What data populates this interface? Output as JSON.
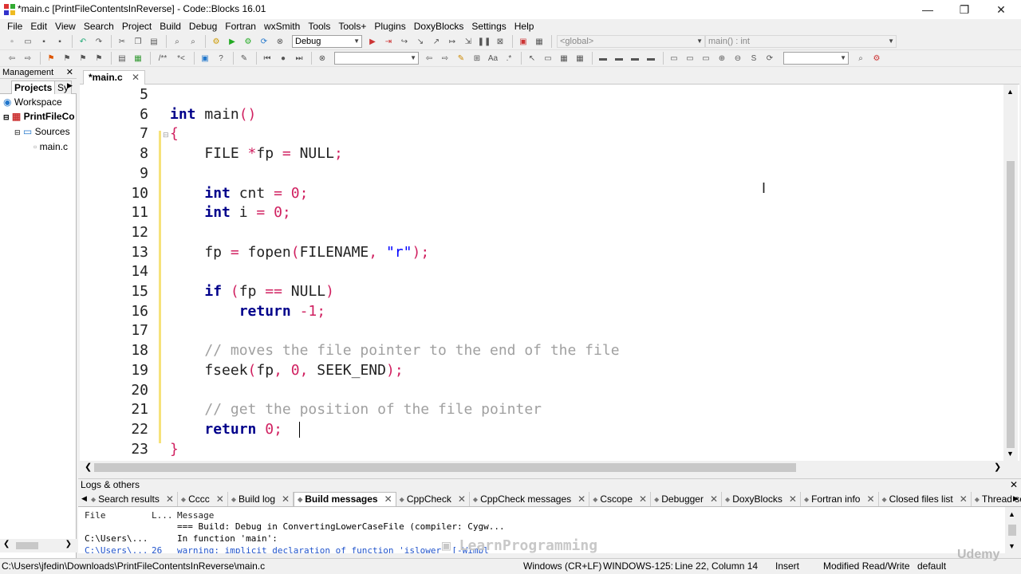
{
  "window": {
    "title": "*main.c [PrintFileContentsInReverse] - Code::Blocks 16.01"
  },
  "menu": [
    "File",
    "Edit",
    "View",
    "Search",
    "Project",
    "Build",
    "Debug",
    "Fortran",
    "wxSmith",
    "Tools",
    "Tools+",
    "Plugins",
    "DoxyBlocks",
    "Settings",
    "Help"
  ],
  "toolbar": {
    "build_target": "Debug",
    "scope": "<global>",
    "function": "main() : int"
  },
  "management": {
    "title": "Management",
    "tabs": [
      "Projects",
      "Sy"
    ],
    "tree": {
      "workspace": "Workspace",
      "project": "PrintFileCo",
      "sources": "Sources",
      "file": "main.c"
    }
  },
  "editor": {
    "tab": "*main.c",
    "lines": [
      {
        "n": "5",
        "html": ""
      },
      {
        "n": "6",
        "html": "<span class=\"kw\">int</span> main<span class=\"op\">()</span>"
      },
      {
        "n": "7",
        "html": "<span class=\"op\">{</span>"
      },
      {
        "n": "8",
        "html": "    FILE <span class=\"op\">*</span>fp <span class=\"op\">=</span> NULL<span class=\"op\">;</span>"
      },
      {
        "n": "9",
        "html": ""
      },
      {
        "n": "10",
        "html": "    <span class=\"kw\">int</span> cnt <span class=\"op\">=</span> <span class=\"num\">0</span><span class=\"op\">;</span>"
      },
      {
        "n": "11",
        "html": "    <span class=\"kw\">int</span> i <span class=\"op\">=</span> <span class=\"num\">0</span><span class=\"op\">;</span>"
      },
      {
        "n": "12",
        "html": ""
      },
      {
        "n": "13",
        "html": "    fp <span class=\"op\">=</span> fopen<span class=\"op\">(</span>FILENAME<span class=\"op\">,</span> <span class=\"str\">\"r\"</span><span class=\"op\">);</span>"
      },
      {
        "n": "14",
        "html": ""
      },
      {
        "n": "15",
        "html": "    <span class=\"kw\">if</span> <span class=\"op\">(</span>fp <span class=\"op\">==</span> NULL<span class=\"op\">)</span>"
      },
      {
        "n": "16",
        "html": "        <span class=\"kw\">return</span> <span class=\"op\">-</span><span class=\"num\">1</span><span class=\"op\">;</span>"
      },
      {
        "n": "17",
        "html": ""
      },
      {
        "n": "18",
        "html": "    <span class=\"cmt\">// moves the file pointer to the end of the file</span>"
      },
      {
        "n": "19",
        "html": "    fseek<span class=\"op\">(</span>fp<span class=\"op\">,</span> <span class=\"num\">0</span><span class=\"op\">,</span> SEEK_END<span class=\"op\">);</span>"
      },
      {
        "n": "20",
        "html": ""
      },
      {
        "n": "21",
        "html": "    <span class=\"cmt\">// get the position of the file pointer</span>"
      },
      {
        "n": "22",
        "html": "    <span class=\"kw\">return</span> <span class=\"num\">0</span><span class=\"op\">;</span>"
      },
      {
        "n": "23",
        "html": "<span class=\"op\">}</span>"
      }
    ]
  },
  "logs": {
    "title": "Logs & others",
    "tabs": [
      "Search results",
      "Cccc",
      "Build log",
      "Build messages",
      "CppCheck",
      "CppCheck messages",
      "Cscope",
      "Debugger",
      "DoxyBlocks",
      "Fortran info",
      "Closed files list",
      "Thread se"
    ],
    "active_tab": "Build messages",
    "columns": [
      "File",
      "L...",
      "Message"
    ],
    "rows": [
      {
        "file": "",
        "line": "",
        "message": "=== Build: Debug in ConvertingLowerCaseFile (compiler: Cygw..."
      },
      {
        "file": "C:\\Users\\...",
        "line": "",
        "message": "In function 'main':"
      },
      {
        "file": "C:\\Users\\...",
        "line": "26",
        "message": "warning: implicit declaration of function 'islower' [-Wimpl"
      }
    ]
  },
  "status": {
    "path": "C:\\Users\\jfedin\\Downloads\\PrintFileContentsInReverse\\main.c",
    "eol": "Windows (CR+LF)",
    "encoding": "WINDOWS-125:",
    "position": "Line 22, Column 14",
    "mode": "Insert",
    "state": "Modified Read/Write",
    "profile": "default"
  }
}
